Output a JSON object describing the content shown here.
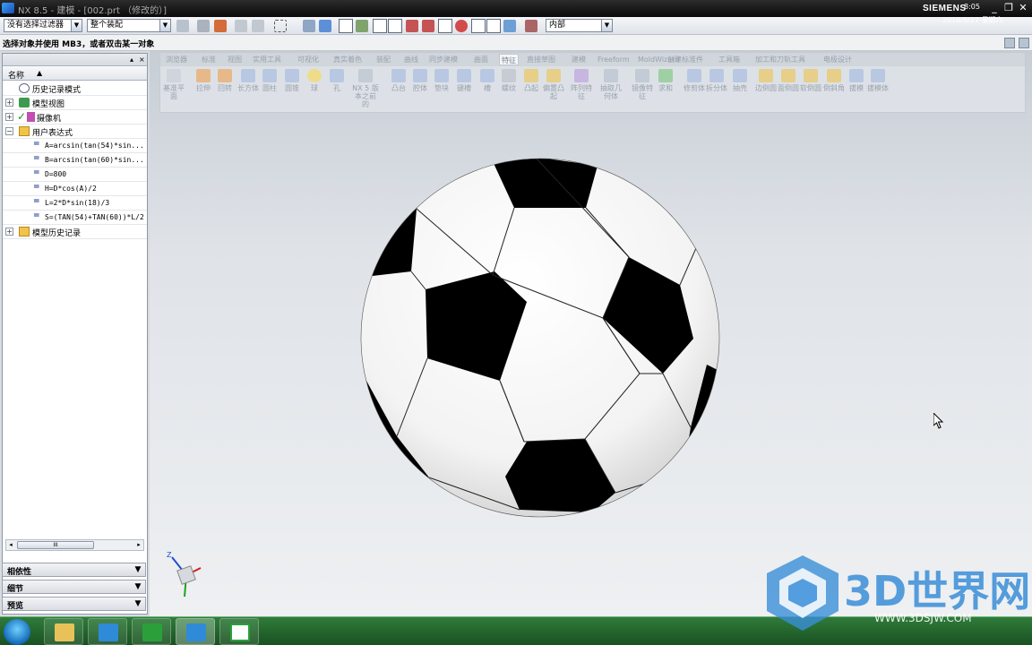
{
  "window": {
    "title": "NX 8.5 - 建模 - [002.prt （修改的）]",
    "brand": "SIEMENS",
    "controls": [
      "_",
      "❐",
      "✕"
    ]
  },
  "toolbar": {
    "filter_combo": "没有选择过滤器",
    "scope_combo": "整个装配",
    "layer_combo": "内部"
  },
  "cue_line": "选择对象并使用 MB3，或者双击某一对象",
  "navigator": {
    "column_header": "名称",
    "sort_glyph": "▲",
    "tree": [
      {
        "label": "历史记录模式",
        "icon": "clock-icon",
        "level": 1,
        "expander": ""
      },
      {
        "label": "模型视图",
        "icon": "model-views-icon",
        "level": 1,
        "expander": "+"
      },
      {
        "label": "摄像机",
        "icon": "camera-icon",
        "level": 1,
        "expander": "+",
        "check": "✓"
      },
      {
        "label": "用户表达式",
        "icon": "folder-icon",
        "level": 1,
        "expander": "−"
      },
      {
        "label": "A=arcsin(tan(54)*sin...",
        "icon": "expression-icon",
        "level": 2,
        "expander": ""
      },
      {
        "label": "B=arcsin(tan(60)*sin...",
        "icon": "expression-icon",
        "level": 2,
        "expander": ""
      },
      {
        "label": "D=800",
        "icon": "expression-icon",
        "level": 2,
        "expander": ""
      },
      {
        "label": "H=D*cos(A)/2",
        "icon": "expression-icon",
        "level": 2,
        "expander": ""
      },
      {
        "label": "L=2*D*sin(18)/3",
        "icon": "expression-icon",
        "level": 2,
        "expander": ""
      },
      {
        "label": "S=(TAN(54)+TAN(60))*L/2",
        "icon": "expression-icon",
        "level": 2,
        "expander": ""
      },
      {
        "label": "模型历史记录",
        "icon": "folder-icon",
        "level": 1,
        "expander": "+"
      }
    ],
    "scroll_thumb": "III",
    "panels": [
      {
        "label": "相依性"
      },
      {
        "label": "细节"
      },
      {
        "label": "预览"
      }
    ]
  },
  "ribbon": {
    "tabs": [
      "浏览器",
      "标准",
      "视图",
      "实用工具",
      "可视化",
      "真实着色",
      "装配",
      "曲线",
      "同步建模",
      "曲面",
      "特征",
      "直接草图",
      "建模",
      "Freeform",
      "MoldWizard",
      "创建标准件",
      "工具箱",
      "加工和刀轨工具",
      "电极设计"
    ],
    "active_tab": "特征",
    "items": [
      {
        "label": "基准平面",
        "icon": "datum-plane-icon"
      },
      {
        "label": "拉伸",
        "icon": "extrude-icon"
      },
      {
        "label": "回转",
        "icon": "revolve-icon"
      },
      {
        "label": "长方体",
        "icon": "block-icon"
      },
      {
        "label": "圆柱",
        "icon": "cylinder-icon"
      },
      {
        "label": "圆锥",
        "icon": "cone-icon"
      },
      {
        "label": "球",
        "icon": "sphere-icon"
      },
      {
        "label": "孔",
        "icon": "hole-icon"
      },
      {
        "label": "NX 5 版本之前的",
        "icon": "legacy-icon"
      },
      {
        "label": "凸台",
        "icon": "boss-icon"
      },
      {
        "label": "腔体",
        "icon": "pocket-icon"
      },
      {
        "label": "垫块",
        "icon": "pad-icon"
      },
      {
        "label": "键槽",
        "icon": "slot-icon"
      },
      {
        "label": "槽",
        "icon": "groove-icon"
      },
      {
        "label": "螺纹",
        "icon": "thread-icon"
      },
      {
        "label": "凸起",
        "icon": "emboss-icon"
      },
      {
        "label": "偏置凸起",
        "icon": "offset-emboss-icon"
      },
      {
        "label": "阵列特征",
        "icon": "pattern-icon"
      },
      {
        "label": "抽取几何体",
        "icon": "extract-icon"
      },
      {
        "label": "镜像特征",
        "icon": "mirror-icon"
      },
      {
        "label": "求和",
        "icon": "unite-icon"
      },
      {
        "label": "修剪体",
        "icon": "trim-body-icon"
      },
      {
        "label": "拆分体",
        "icon": "split-body-icon"
      },
      {
        "label": "抽壳",
        "icon": "shell-icon"
      },
      {
        "label": "边倒圆",
        "icon": "edge-blend-icon"
      },
      {
        "label": "面倒圆",
        "icon": "face-blend-icon"
      },
      {
        "label": "软倒圆",
        "icon": "soft-blend-icon"
      },
      {
        "label": "倒斜角",
        "icon": "chamfer-icon"
      },
      {
        "label": "拔模",
        "icon": "draft-icon"
      },
      {
        "label": "拔模体",
        "icon": "draft-body-icon"
      }
    ]
  },
  "model": {
    "object": "soccer-ball",
    "colors": {
      "white": "#ffffff",
      "black": "#000000"
    }
  },
  "triad": {
    "z_label": "Z"
  },
  "watermark": {
    "text": "3D世界网",
    "url": "WWW.3DSJW.COM",
    "color": "#3a8ed8"
  },
  "taskbar": {
    "apps": [
      {
        "name": "folder-app-icon"
      },
      {
        "name": "nx-app-icon"
      },
      {
        "name": "camtasia-app-icon"
      },
      {
        "name": "nx-app-icon"
      },
      {
        "name": "camtasia-app-icon"
      }
    ],
    "time": "8:05",
    "date": "2016/8/27 星期六"
  }
}
